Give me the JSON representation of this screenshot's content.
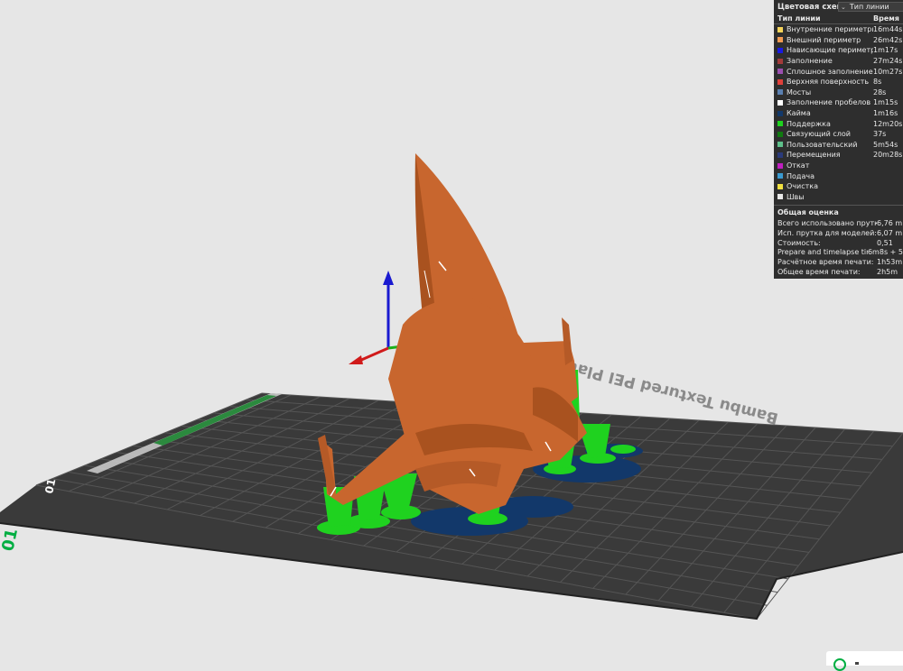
{
  "legend": {
    "title": "Цветовая схема",
    "dropdown_value": "Тип линии",
    "col_type": "Тип линии",
    "col_time": "Время",
    "rows": [
      {
        "label": "Внутренние периметры",
        "time": "16m44s",
        "color": "#f4d35a"
      },
      {
        "label": "Внешний периметр",
        "time": "26m42s",
        "color": "#f09a52"
      },
      {
        "label": "Нависающие периметры",
        "time": "1m17s",
        "color": "#1a1ae0"
      },
      {
        "label": "Заполнение",
        "time": "27m24s",
        "color": "#a23a3a"
      },
      {
        "label": "Сплошное заполнение",
        "time": "10m27s",
        "color": "#9b4fb0"
      },
      {
        "label": "Верхняя поверхность",
        "time": "8s",
        "color": "#e0403a"
      },
      {
        "label": "Мосты",
        "time": "28s",
        "color": "#5a7fb0"
      },
      {
        "label": "Заполнение пробелов",
        "time": "1m15s",
        "color": "#ffffff"
      },
      {
        "label": "Кайма",
        "time": "1m16s",
        "color": "#12386a"
      },
      {
        "label": "Поддержка",
        "time": "12m20s",
        "color": "#1fd21f"
      },
      {
        "label": "Связующий слой",
        "time": "37s",
        "color": "#107a10"
      },
      {
        "label": "Пользовательский",
        "time": "5m54s",
        "color": "#5ec08a"
      },
      {
        "label": "Перемещения",
        "time": "20m28s",
        "color": "#2a3a7a"
      },
      {
        "label": "Откат",
        "time": "",
        "color": "#c01fc0"
      },
      {
        "label": "Подача",
        "time": "",
        "color": "#3a9ad0"
      },
      {
        "label": "Очистка",
        "time": "",
        "color": "#f0e040"
      },
      {
        "label": "Швы",
        "time": "",
        "color": "#e8e8e8"
      }
    ],
    "summary_title": "Общая оценка",
    "summary": [
      {
        "label": "Всего использовано прутка:",
        "value": "6,76 m"
      },
      {
        "label": "Исп. прутка для моделей:",
        "value": "6,07 m"
      },
      {
        "label": "Стоимость:",
        "value": "0,51"
      },
      {
        "label": "Prepare and timelapse time:",
        "value": "6m8s + 5"
      },
      {
        "label": "Расчётное время печати:",
        "value": "1h53m"
      },
      {
        "label": "Общее время печати:",
        "value": "2h5m"
      }
    ]
  },
  "plate": {
    "label": "Bambu Textured PEI Plate",
    "number": "01"
  },
  "colors": {
    "model": "#c8662e",
    "support": "#1fd21f",
    "brim": "#12386a",
    "bed": "#3a3a3a",
    "grid": "#5a5a5a",
    "axis_z": "#1a1ad0",
    "axis_x": "#d01a1a",
    "axis_y": "#1ab01a"
  }
}
